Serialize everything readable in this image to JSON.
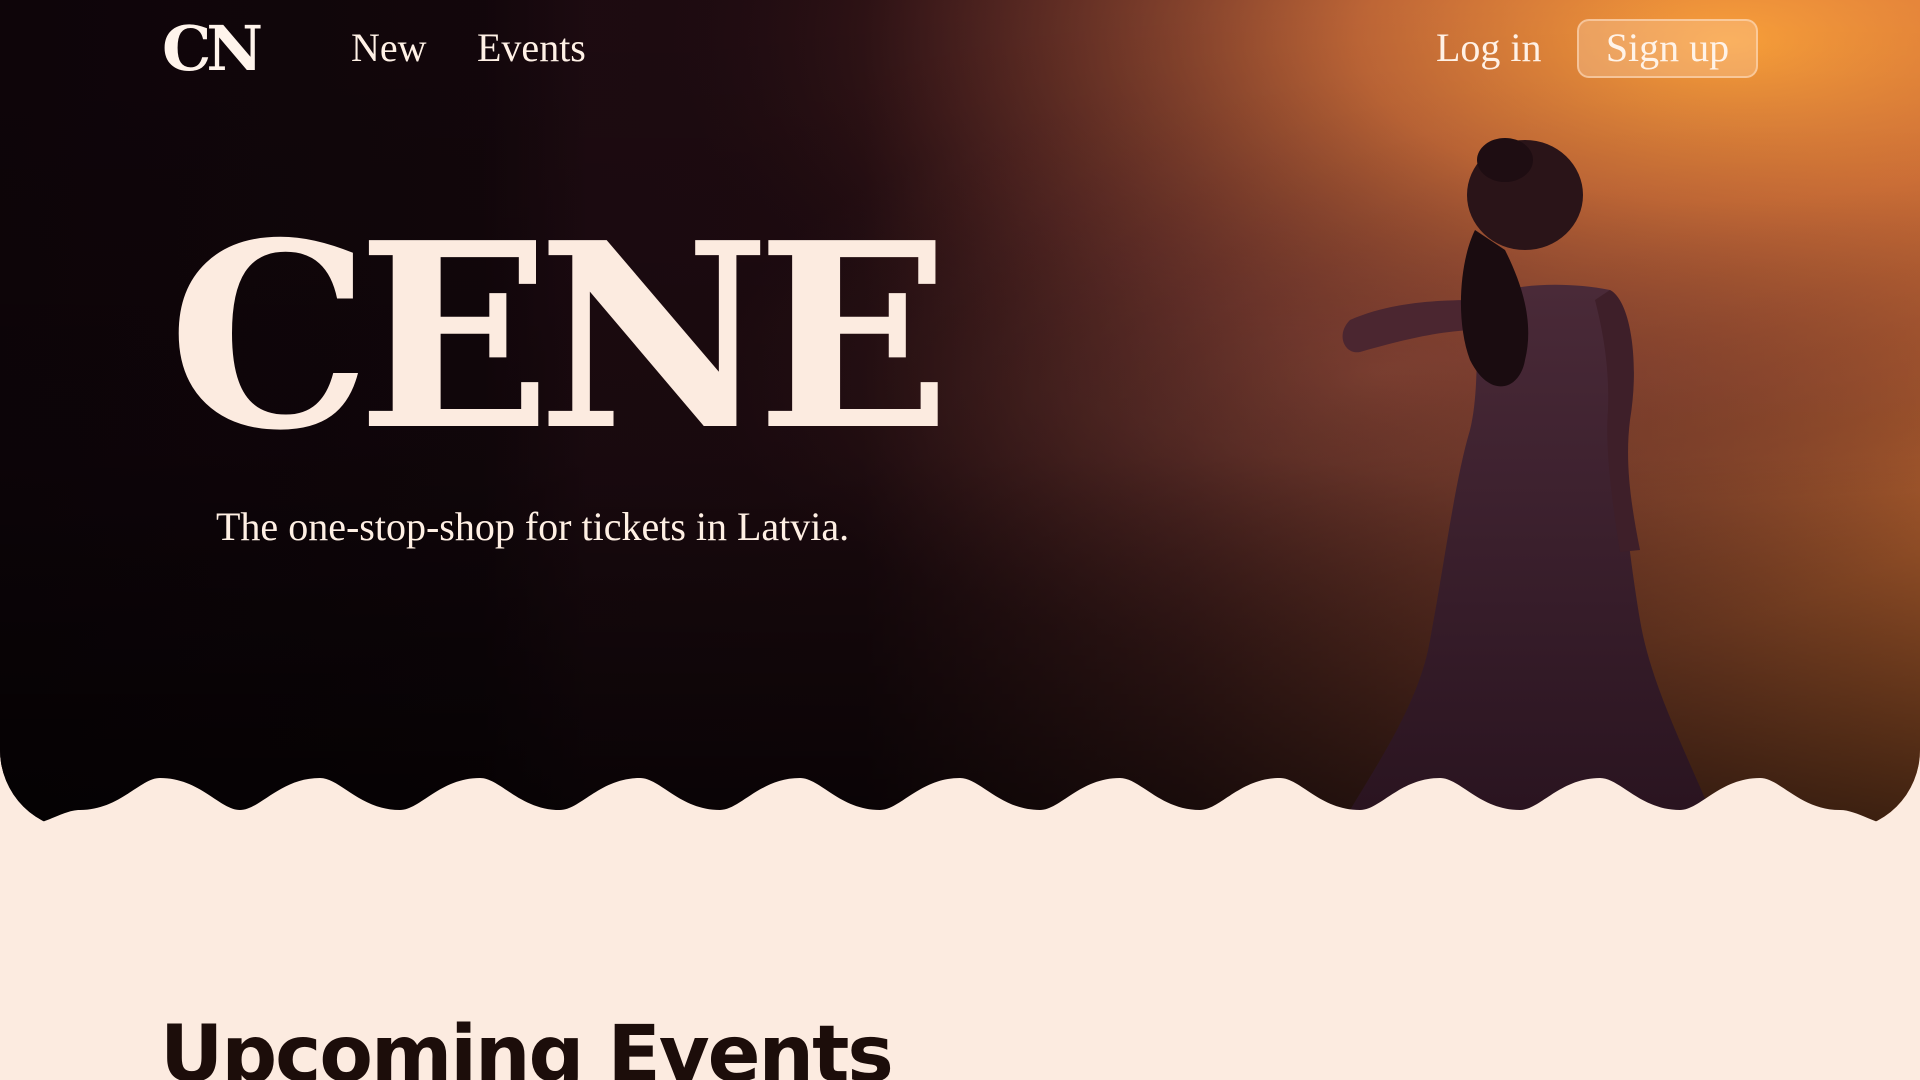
{
  "nav": {
    "logo": "CN",
    "links": [
      {
        "label": "New"
      },
      {
        "label": "Events"
      }
    ],
    "login_label": "Log in",
    "signup_label": "Sign up"
  },
  "hero": {
    "title": "CENE",
    "tagline": "The one-stop-shop for tickets in Latvia.",
    "image": "dancer-in-orange-smoke-photo"
  },
  "sections": {
    "upcoming_title": "Upcoming Events"
  },
  "colors": {
    "background": "#fcebe0",
    "hero_dark": "#120709",
    "hero_glow": "#e98a3a",
    "text_light": "#fcebe0",
    "text_dark": "#1c0d0a"
  }
}
